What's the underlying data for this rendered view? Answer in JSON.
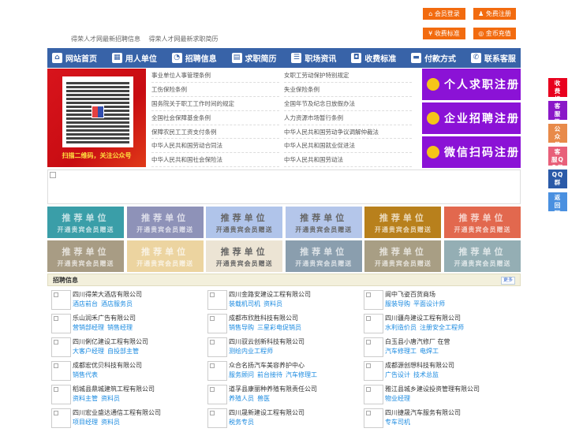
{
  "top_buttons": [
    {
      "label": "会员登录",
      "icon": "home-icon",
      "color": "#f26b0f"
    },
    {
      "label": "免费注册",
      "icon": "user-icon",
      "color": "#f26b0f"
    },
    {
      "label": "收费标准",
      "icon": "yen-icon",
      "color": "#f26b0f"
    },
    {
      "label": "金币充值",
      "icon": "coins-icon",
      "color": "#f26b0f"
    }
  ],
  "top_links": [
    "得荣人才网最新招聘信息",
    "得荣人才网最新求职简历"
  ],
  "nav": [
    {
      "label": "网站首页",
      "icon": "home-icon"
    },
    {
      "label": "用人单位",
      "icon": "building-icon"
    },
    {
      "label": "招聘信息",
      "icon": "search-chart-icon"
    },
    {
      "label": "求职简历",
      "icon": "resume-icon"
    },
    {
      "label": "职场资讯",
      "icon": "document-icon"
    },
    {
      "label": "收费标准",
      "icon": "money-bag-icon"
    },
    {
      "label": "付款方式",
      "icon": "card-icon"
    },
    {
      "label": "联系客服",
      "icon": "phone-icon"
    }
  ],
  "qr_caption": "扫描二维码，关注公众号",
  "laws": [
    "事业单位人事管理条例",
    "女职工劳动保护特别规定",
    "工伤保险条例",
    "失业保险条例",
    "国务院关于职工工作时间的规定",
    "全国年节及纪念日放假办法",
    "全国社会保障基金条例",
    "人力资源市场暂行条例",
    "保障农民工工资支付条例",
    "中华人民共和国劳动争议调解仲裁法",
    "中华人民共和国劳动合同法",
    "中华人民共和国就业促进法",
    "中华人民共和国社会保险法",
    "中华人民共和国劳动法"
  ],
  "register": [
    {
      "label": "个人求职注册",
      "icon": "person-add-icon"
    },
    {
      "label": "企业招聘注册",
      "icon": "company-chart-icon"
    },
    {
      "label": "微信扫码注册",
      "icon": "wechat-icon"
    }
  ],
  "accent_purple": "#8b12d6",
  "tiles": {
    "title": "推荐单位",
    "subtitle": "开通贵宾会员赠送",
    "colors": [
      "#3a9ea8",
      "#8e92b8",
      "#b0c4ea",
      "#b4c6ea",
      "#b8801c",
      "#e2684e",
      "#a89c84",
      "#ecd4a0",
      "#ece4d4",
      "#8a9eae",
      "#a89e84",
      "#94aeb4"
    ]
  },
  "section": {
    "title": "招聘信息",
    "more": "更多"
  },
  "jobs": [
    {
      "company": "四川得荣大酒店有限公司",
      "positions": [
        "酒店前台",
        "酒店服务员"
      ]
    },
    {
      "company": "四川金路安建设工程有限公司",
      "positions": [
        "装载机司机",
        "资料员"
      ]
    },
    {
      "company": "阆中飞姿百货商场",
      "positions": [
        "服装导购",
        "平面设计师"
      ]
    },
    {
      "company": "乐山润禾广告有限公司",
      "positions": [
        "营销部经理",
        "销售经理"
      ]
    },
    {
      "company": "成都市欣胜科技有限公司",
      "positions": [
        "销售导购",
        "三星彩电促销员"
      ]
    },
    {
      "company": "四川疆舟建设工程有限公司",
      "positions": [
        "水利造价员",
        "注册安全工程师"
      ]
    },
    {
      "company": "四川俐亿建设工程有限公司",
      "positions": [
        "大客户经理",
        "自投部主管"
      ]
    },
    {
      "company": "四川驭云创新科技有限公司",
      "positions": [
        "测绘内业工程师"
      ]
    },
    {
      "company": "白玉县小唐汽修厂 在营",
      "positions": [
        "汽车修理工",
        "电焊工"
      ]
    },
    {
      "company": "成都宏优贝科技有限公司",
      "positions": [
        "销售代表"
      ]
    },
    {
      "company": "众合名扬汽车美容养护中心",
      "positions": [
        "服务顾问",
        "前台接待",
        "汽车修理工"
      ]
    },
    {
      "company": "成都源创想科技有限公司",
      "positions": [
        "广告设计",
        "技术总监"
      ]
    },
    {
      "company": "稻城县鼎城建筑工程有限公司",
      "positions": [
        "资料主管",
        "资料员"
      ]
    },
    {
      "company": "道孚县康丽种养殖有限责任公司",
      "positions": [
        "养殖人员",
        "兽医"
      ]
    },
    {
      "company": "雅江县城乡建设投资管理有限公司",
      "positions": [
        "物业经理"
      ]
    },
    {
      "company": "四川宏业盛达通信工程有限公司",
      "positions": [
        "项目经理",
        "资料员"
      ]
    },
    {
      "company": "四川晟新建设工程有限公司",
      "positions": [
        "税务专员"
      ]
    },
    {
      "company": "四川捷晟汽车服务有限公司",
      "positions": [
        "专车司机"
      ]
    }
  ],
  "side_buttons": [
    {
      "label": "收费标准",
      "color": "#e8001e"
    },
    {
      "label": "客服微信",
      "color": "#8a18c8"
    },
    {
      "label": "公众号",
      "color": "#e88a4a"
    },
    {
      "label": "客服QQ号",
      "color": "#e8607a"
    },
    {
      "label": "QQ群",
      "color": "#2a5aa8"
    },
    {
      "label": "返回顶部",
      "color": "#4a90e0"
    }
  ]
}
